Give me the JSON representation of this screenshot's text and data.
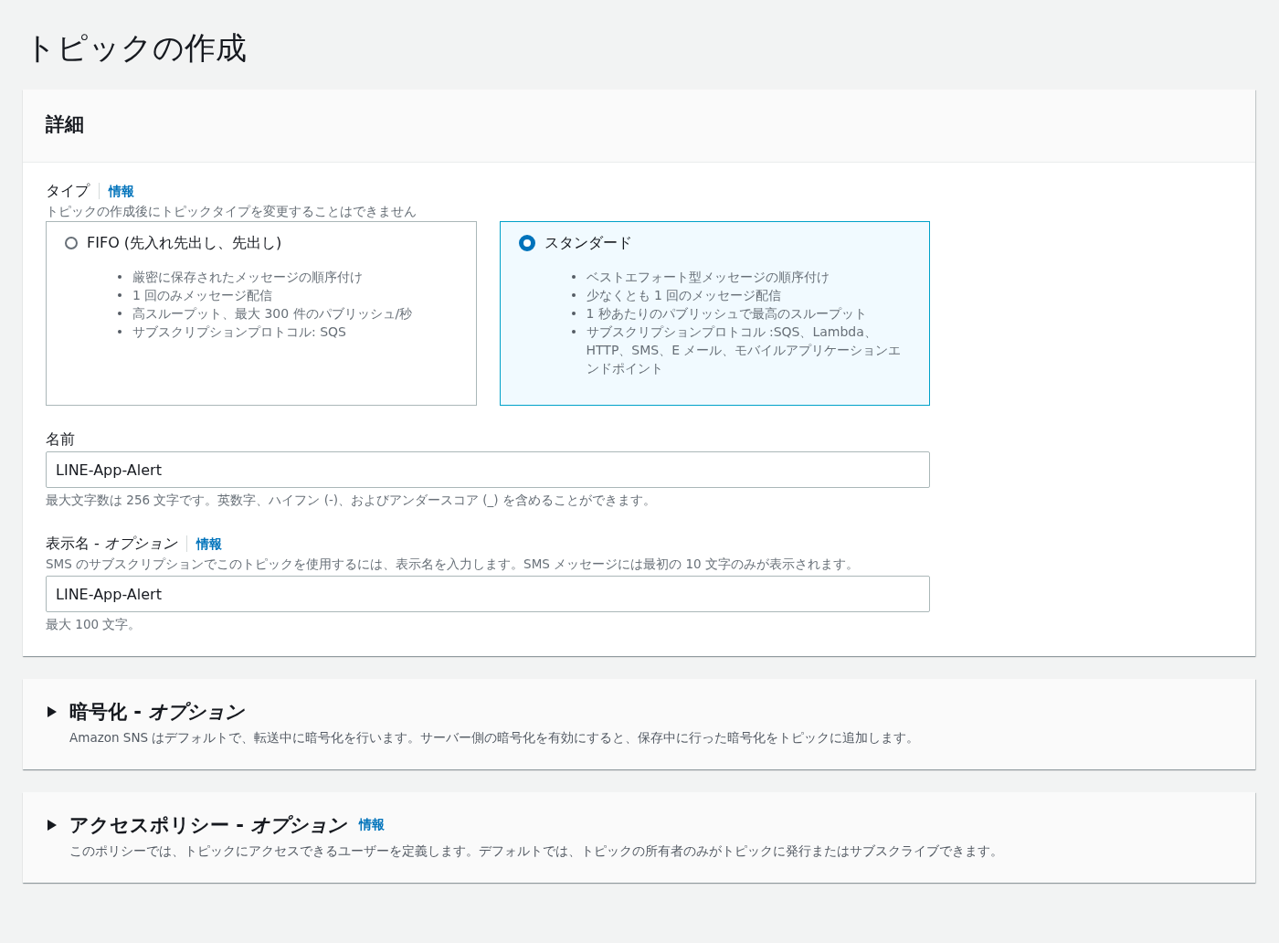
{
  "page_title": "トピックの作成",
  "details": {
    "title": "詳細",
    "type_field": {
      "label": "タイプ",
      "info": "情報",
      "description": "トピックの作成後にトピックタイプを変更することはできません",
      "options": [
        {
          "label": "FIFO (先入れ先出し、先出し)",
          "selected": false,
          "bullets": [
            "厳密に保存されたメッセージの順序付け",
            "1 回のみメッセージ配信",
            "高スループット、最大 300 件のパブリッシュ/秒",
            "サブスクリプションプロトコル: SQS"
          ]
        },
        {
          "label": "スタンダード",
          "selected": true,
          "bullets": [
            "ベストエフォート型メッセージの順序付け",
            "少なくとも 1 回のメッセージ配信",
            "1 秒あたりのパブリッシュで最高のスループット",
            "サブスクリプションプロトコル :SQS、Lambda、HTTP、SMS、E メール、モバイルアプリケーションエンドポイント"
          ]
        }
      ]
    },
    "name_field": {
      "label": "名前",
      "value": "LINE-App-Alert",
      "hint": "最大文字数は 256 文字です。英数字、ハイフン (-)、およびアンダースコア (_) を含めることができます。"
    },
    "display_name_field": {
      "label": "表示名 - *オプション*",
      "info": "情報",
      "description": "SMS のサブスクリプションでこのトピックを使用するには、表示名を入力します。SMS メッセージには最初の 10 文字のみが表示されます。",
      "value": "LINE-App-Alert",
      "hint": "最大 100 文字。"
    }
  },
  "sections": [
    {
      "title": "暗号化 - *オプション*",
      "expanded": false,
      "description": "Amazon SNS はデフォルトで、転送中に暗号化を行います。サーバー側の暗号化を有効にすると、保存中に行った暗号化をトピックに追加します。"
    },
    {
      "title": "アクセスポリシー - *オプション*",
      "info": "情報",
      "expanded": false,
      "description": "このポリシーでは、トピックにアクセスできるユーザーを定義します。デフォルトでは、トピックの所有者のみがトピックに発行またはサブスクライブできます。"
    }
  ]
}
